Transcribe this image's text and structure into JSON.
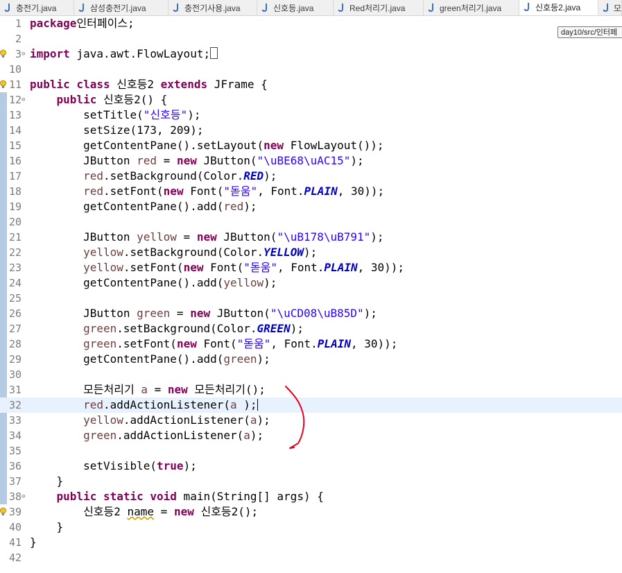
{
  "tabs": [
    {
      "label": "충전기.java",
      "icon": "java-file-icon",
      "active": false
    },
    {
      "label": "삼성충전기.java",
      "icon": "java-file-icon",
      "active": false
    },
    {
      "label": "충전기사용.java",
      "icon": "java-file-icon",
      "active": false
    },
    {
      "label": "신호등.java",
      "icon": "java-file-icon",
      "active": false
    },
    {
      "label": "Red처리기.java",
      "icon": "java-file-icon",
      "active": false
    },
    {
      "label": "green처리기.java",
      "icon": "java-file-icon",
      "active": false
    },
    {
      "label": "신호등2.java",
      "icon": "java-file-icon",
      "active": true
    },
    {
      "label": "모",
      "icon": "java-file-icon",
      "active": false
    }
  ],
  "tooltip": "day10/src/인터페",
  "colors": {
    "keyword": "#7f0055",
    "string": "#2a00ff",
    "field": "#0000c0",
    "line_number": "#7b7b7b",
    "current_line": "#e8f2fe",
    "annotation": "#e8001c"
  },
  "lines": [
    {
      "num": "1",
      "marker": "",
      "fold": "",
      "segs": [
        [
          "kw",
          "package"
        ],
        [
          "",
          "인터페이스;"
        ]
      ]
    },
    {
      "num": "2",
      "marker": "",
      "fold": "",
      "segs": []
    },
    {
      "num": "3",
      "marker": "bulb",
      "fold": "⊖",
      "segs": [
        [
          "kw",
          "import"
        ],
        [
          "",
          " java.awt.FlowLayout;"
        ],
        [
          "box",
          ""
        ]
      ]
    },
    {
      "num": "10",
      "marker": "",
      "fold": "",
      "segs": []
    },
    {
      "num": "11",
      "marker": "bulb",
      "fold": "",
      "segs": [
        [
          "kw",
          "public class"
        ],
        [
          "",
          " 신호등2 "
        ],
        [
          "kw",
          "extends"
        ],
        [
          "",
          " JFrame {"
        ]
      ]
    },
    {
      "num": "12",
      "marker": "",
      "fold": "⊖",
      "segs": [
        [
          "",
          "    "
        ],
        [
          "kw",
          "public"
        ],
        [
          "",
          " 신호등2() {"
        ]
      ]
    },
    {
      "num": "13",
      "marker": "",
      "fold": "",
      "segs": [
        [
          "",
          "        setTitle("
        ],
        [
          "str",
          "\"신호등\""
        ],
        [
          "",
          ");"
        ]
      ]
    },
    {
      "num": "14",
      "marker": "",
      "fold": "",
      "segs": [
        [
          "",
          "        setSize(173, 209);"
        ]
      ]
    },
    {
      "num": "15",
      "marker": "",
      "fold": "",
      "segs": [
        [
          "",
          "        getContentPane().setLayout("
        ],
        [
          "kw",
          "new"
        ],
        [
          "",
          " FlowLayout());"
        ]
      ]
    },
    {
      "num": "16",
      "marker": "",
      "fold": "",
      "segs": [
        [
          "",
          "        JButton "
        ],
        [
          "var",
          "red"
        ],
        [
          "",
          " = "
        ],
        [
          "kw",
          "new"
        ],
        [
          "",
          " JButton("
        ],
        [
          "str",
          "\"\\uBE68\\uAC15\""
        ],
        [
          "",
          ");"
        ]
      ]
    },
    {
      "num": "17",
      "marker": "",
      "fold": "",
      "segs": [
        [
          "",
          "        "
        ],
        [
          "var",
          "red"
        ],
        [
          "",
          ".setBackground(Color."
        ],
        [
          "sfld",
          "RED"
        ],
        [
          "",
          ");"
        ]
      ]
    },
    {
      "num": "18",
      "marker": "",
      "fold": "",
      "segs": [
        [
          "",
          "        "
        ],
        [
          "var",
          "red"
        ],
        [
          "",
          ".setFont("
        ],
        [
          "kw",
          "new"
        ],
        [
          "",
          " Font("
        ],
        [
          "str",
          "\"돋움\""
        ],
        [
          "",
          ", Font."
        ],
        [
          "sfld",
          "PLAIN"
        ],
        [
          "",
          ", 30));"
        ]
      ]
    },
    {
      "num": "19",
      "marker": "",
      "fold": "",
      "segs": [
        [
          "",
          "        getContentPane().add("
        ],
        [
          "var",
          "red"
        ],
        [
          "",
          ");"
        ]
      ]
    },
    {
      "num": "20",
      "marker": "",
      "fold": "",
      "segs": []
    },
    {
      "num": "21",
      "marker": "",
      "fold": "",
      "segs": [
        [
          "",
          "        JButton "
        ],
        [
          "var",
          "yellow"
        ],
        [
          "",
          " = "
        ],
        [
          "kw",
          "new"
        ],
        [
          "",
          " JButton("
        ],
        [
          "str",
          "\"\\uB178\\uB791\""
        ],
        [
          "",
          ");"
        ]
      ]
    },
    {
      "num": "22",
      "marker": "",
      "fold": "",
      "segs": [
        [
          "",
          "        "
        ],
        [
          "var",
          "yellow"
        ],
        [
          "",
          ".setBackground(Color."
        ],
        [
          "sfld",
          "YELLOW"
        ],
        [
          "",
          ");"
        ]
      ]
    },
    {
      "num": "23",
      "marker": "",
      "fold": "",
      "segs": [
        [
          "",
          "        "
        ],
        [
          "var",
          "yellow"
        ],
        [
          "",
          ".setFont("
        ],
        [
          "kw",
          "new"
        ],
        [
          "",
          " Font("
        ],
        [
          "str",
          "\"돋움\""
        ],
        [
          "",
          ", Font."
        ],
        [
          "sfld",
          "PLAIN"
        ],
        [
          "",
          ", 30));"
        ]
      ]
    },
    {
      "num": "24",
      "marker": "",
      "fold": "",
      "segs": [
        [
          "",
          "        getContentPane().add("
        ],
        [
          "var",
          "yellow"
        ],
        [
          "",
          ");"
        ]
      ]
    },
    {
      "num": "25",
      "marker": "",
      "fold": "",
      "segs": []
    },
    {
      "num": "26",
      "marker": "",
      "fold": "",
      "segs": [
        [
          "",
          "        JButton "
        ],
        [
          "var",
          "green"
        ],
        [
          "",
          " = "
        ],
        [
          "kw",
          "new"
        ],
        [
          "",
          " JButton("
        ],
        [
          "str",
          "\"\\uCD08\\uB85D\""
        ],
        [
          "",
          ");"
        ]
      ]
    },
    {
      "num": "27",
      "marker": "",
      "fold": "",
      "segs": [
        [
          "",
          "        "
        ],
        [
          "var",
          "green"
        ],
        [
          "",
          ".setBackground(Color."
        ],
        [
          "sfld",
          "GREEN"
        ],
        [
          "",
          ");"
        ]
      ]
    },
    {
      "num": "28",
      "marker": "",
      "fold": "",
      "segs": [
        [
          "",
          "        "
        ],
        [
          "var",
          "green"
        ],
        [
          "",
          ".setFont("
        ],
        [
          "kw",
          "new"
        ],
        [
          "",
          " Font("
        ],
        [
          "str",
          "\"돋움\""
        ],
        [
          "",
          ", Font."
        ],
        [
          "sfld",
          "PLAIN"
        ],
        [
          "",
          ", 30));"
        ]
      ]
    },
    {
      "num": "29",
      "marker": "",
      "fold": "",
      "segs": [
        [
          "",
          "        getContentPane().add("
        ],
        [
          "var",
          "green"
        ],
        [
          "",
          ");"
        ]
      ]
    },
    {
      "num": "30",
      "marker": "",
      "fold": "",
      "segs": []
    },
    {
      "num": "31",
      "marker": "",
      "fold": "",
      "segs": [
        [
          "",
          "        모든처리기 "
        ],
        [
          "var",
          "a"
        ],
        [
          "",
          " = "
        ],
        [
          "kw",
          "new"
        ],
        [
          "",
          " 모든처리기();"
        ]
      ]
    },
    {
      "num": "32",
      "marker": "",
      "fold": "",
      "current": true,
      "segs": [
        [
          "",
          "        "
        ],
        [
          "var",
          "red"
        ],
        [
          "",
          ".addActionListener("
        ],
        [
          "var",
          "a"
        ],
        [
          "",
          " );"
        ],
        [
          "caret",
          ""
        ]
      ]
    },
    {
      "num": "33",
      "marker": "",
      "fold": "",
      "segs": [
        [
          "",
          "        "
        ],
        [
          "var",
          "yellow"
        ],
        [
          "",
          ".addActionListener("
        ],
        [
          "var",
          "a"
        ],
        [
          "",
          ");"
        ]
      ]
    },
    {
      "num": "34",
      "marker": "",
      "fold": "",
      "segs": [
        [
          "",
          "        "
        ],
        [
          "var",
          "green"
        ],
        [
          "",
          ".addActionListener("
        ],
        [
          "var",
          "a"
        ],
        [
          "",
          ");"
        ]
      ]
    },
    {
      "num": "35",
      "marker": "",
      "fold": "",
      "segs": []
    },
    {
      "num": "36",
      "marker": "",
      "fold": "",
      "segs": [
        [
          "",
          "        setVisible("
        ],
        [
          "kw",
          "true"
        ],
        [
          "",
          ");"
        ]
      ]
    },
    {
      "num": "37",
      "marker": "",
      "fold": "",
      "segs": [
        [
          "",
          "    }"
        ]
      ]
    },
    {
      "num": "38",
      "marker": "",
      "fold": "⊖",
      "segs": [
        [
          "",
          "    "
        ],
        [
          "kw",
          "public static void"
        ],
        [
          "",
          " main(String[] args) {"
        ]
      ]
    },
    {
      "num": "39",
      "marker": "bulb",
      "fold": "",
      "segs": [
        [
          "",
          "        신호등2 "
        ],
        [
          "warn",
          "name"
        ],
        [
          "",
          " = "
        ],
        [
          "kw",
          "new"
        ],
        [
          "",
          " 신호등2();"
        ]
      ]
    },
    {
      "num": "40",
      "marker": "",
      "fold": "",
      "segs": [
        [
          "",
          "    }"
        ]
      ]
    },
    {
      "num": "41",
      "marker": "",
      "fold": "",
      "segs": [
        [
          "",
          "}"
        ]
      ]
    },
    {
      "num": "42",
      "marker": "",
      "fold": "",
      "segs": []
    }
  ]
}
